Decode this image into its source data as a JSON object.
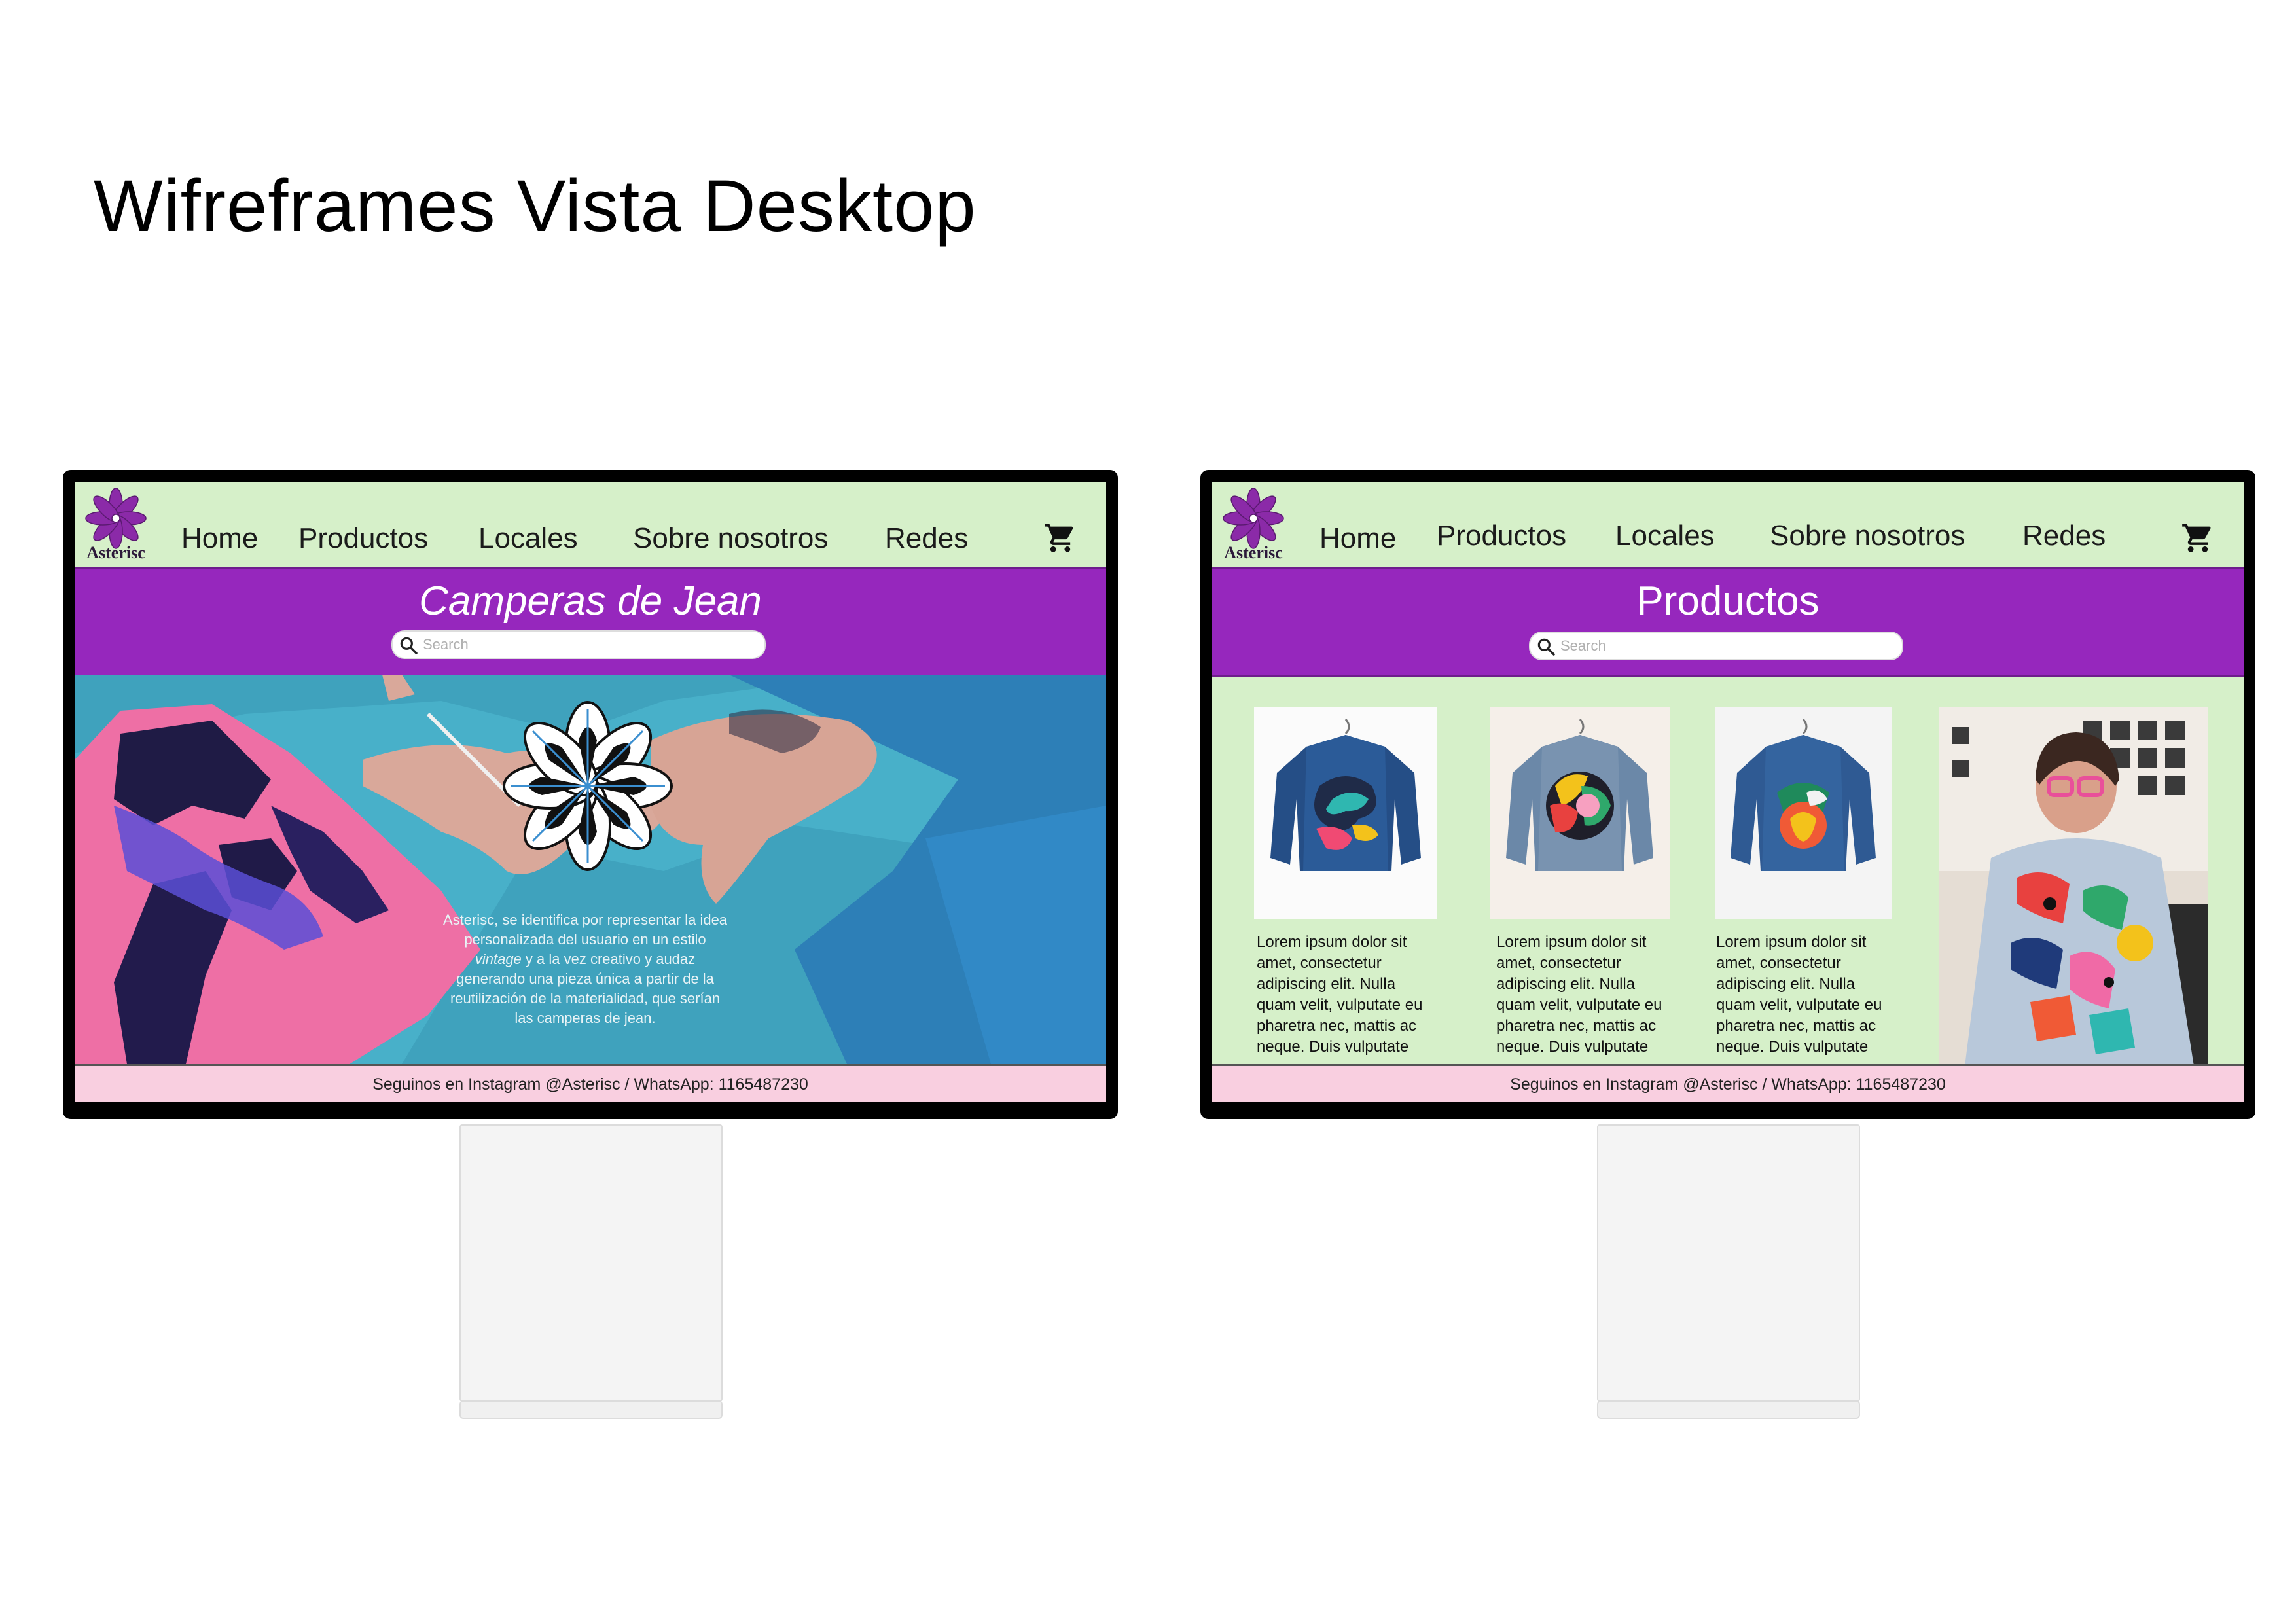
{
  "page": {
    "title": "Wifreframes Vista Desktop"
  },
  "brand": {
    "name": "Asterisc"
  },
  "colors": {
    "nav_bg": "#d6f0c9",
    "banner_bg": "#9627bd",
    "footer_bg": "#f9cfe0",
    "logo_purple": "#8b2aa8"
  },
  "nav": {
    "items": [
      "Home",
      "Productos",
      "Locales",
      "Sobre nosotros",
      "Redes"
    ],
    "cart_icon": "cart-icon"
  },
  "search": {
    "placeholder": "Search"
  },
  "screens": [
    {
      "banner_title": "Camperas de Jean",
      "hero": {
        "text_before_italic": "Asterisc, se identifica por representar la idea personalizada del usuario en un estilo ",
        "italic": "vintage",
        "text_after_italic": " y a la vez creativo y audaz generando una pieza única a partir de la reutilización de la materialidad, que serían las camperas de jean."
      }
    },
    {
      "banner_title": "Productos",
      "products": [
        {
          "description": "Lorem ipsum dolor sit amet, consectetur adipiscing elit. Nulla quam velit, vulputate eu pharetra nec, mattis ac neque. Duis vulputate"
        },
        {
          "description": "Lorem ipsum dolor sit amet, consectetur adipiscing elit. Nulla quam velit, vulputate eu pharetra nec, mattis ac neque. Duis vulputate"
        },
        {
          "description": "Lorem ipsum dolor sit amet, consectetur adipiscing elit. Nulla quam velit, vulputate eu pharetra nec, mattis ac neque. Duis vulputate"
        }
      ]
    }
  ],
  "footer": {
    "text": "Seguinos en Instagram @Asterisc / WhatsApp: 1165487230"
  }
}
